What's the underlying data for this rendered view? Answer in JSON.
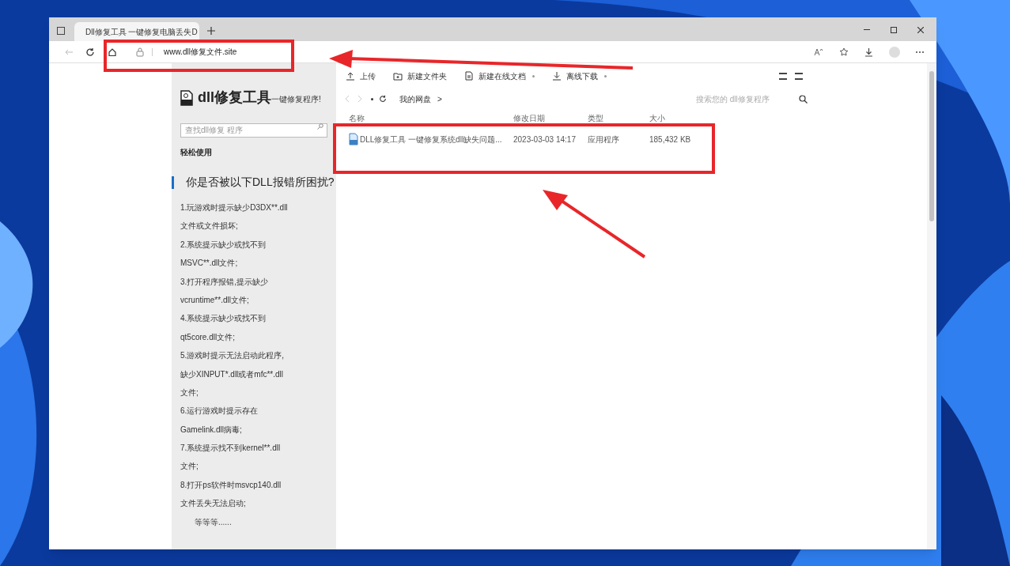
{
  "browser": {
    "tab_title": "Dll修复工具 一键修复电脑丢失D",
    "url": "www.dll修复文件.site"
  },
  "sidebar": {
    "title": "dll修复工具",
    "subtitle": "一键修复程序!",
    "search_placeholder": "查找dll修复 程序",
    "section": "轻松使用",
    "heading": "你是否被以下DLL报错所困扰?",
    "lines": [
      "1.玩游戏时提示缺少D3DX**.dll",
      "文件或文件损坏;",
      "2.系统提示缺少或找不到",
      "MSVC**.dll文件;",
      "3.打开程序报错,提示缺少",
      "vcruntime**.dll文件;",
      "4.系统提示缺少或找不到",
      "qt5core.dll文件;",
      "5.游戏时提示无法启动此程序,",
      "缺少XINPUT*.dll或者mfc**.dll",
      "文件;",
      "6.运行游戏时提示存在",
      "Gamelink.dll病毒;",
      "7.系统提示找不到kernel**.dll",
      "文件;",
      "8.打开ps软件时msvcp140.dll",
      "文件丢失无法启动;"
    ],
    "ending": "等等等......"
  },
  "toolbar": [
    {
      "label": "上传",
      "kind": "upload",
      "dropdown": false
    },
    {
      "label": "新建文件夹",
      "kind": "folder",
      "dropdown": false
    },
    {
      "label": "新建在线文档",
      "kind": "doc",
      "dropdown": true
    },
    {
      "label": "离线下载",
      "kind": "download",
      "dropdown": true
    }
  ],
  "breadcrumb": "我的网盘",
  "breadcrumb_sep": ">",
  "file_search_placeholder": "搜索您的 dll修复程序",
  "table": {
    "columns": [
      "名称",
      "修改日期",
      "类型",
      "大小"
    ],
    "rows": [
      {
        "name": "DLL修复工具 一键修复系统dll缺失问题...",
        "date": "2023-03-03 14:17",
        "type": "应用程序",
        "size": "185,432 KB"
      }
    ]
  }
}
